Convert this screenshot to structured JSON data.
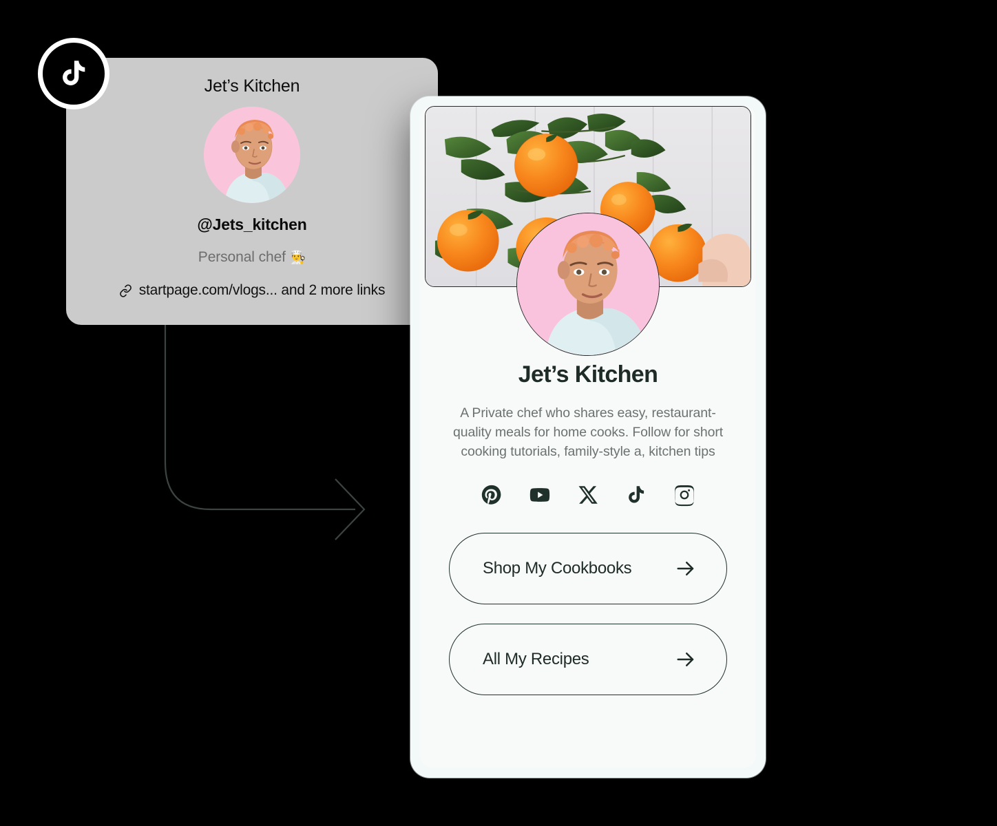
{
  "theme": {
    "background": "#000000",
    "card_bg": "#cbcbcb",
    "phone_frame": "#f3f8f8",
    "screen_bg": "#f8faf9",
    "text_dark": "#1e2b26",
    "text_muted": "#6b7270",
    "avatar_pink": "#f9c2dd",
    "accent_orange": "#f58220"
  },
  "badge": {
    "platform": "tiktok",
    "icon": "tiktok-icon"
  },
  "profile_card": {
    "title": "Jet’s Kitchen",
    "avatar_alt": "profile-photo",
    "handle": "@Jets_kitchen",
    "bio": "Personal chef",
    "bio_emoji": "👨‍🍳",
    "link_icon": "link-chain-icon",
    "links_text": "startpage.com/vlogs... and 2 more links"
  },
  "phone": {
    "cover_alt": "oranges-flatlay-cover-image",
    "avatar_alt": "profile-photo",
    "title": "Jet’s Kitchen",
    "bio": "A Private chef who shares easy, restaurant-quality meals for home cooks. Follow for short cooking tutorials, family-style a, kitchen tips",
    "socials": [
      {
        "name": "pinterest",
        "icon": "pinterest-icon"
      },
      {
        "name": "youtube",
        "icon": "youtube-icon"
      },
      {
        "name": "x",
        "icon": "x-icon"
      },
      {
        "name": "tiktok",
        "icon": "tiktok-icon"
      },
      {
        "name": "instagram",
        "icon": "instagram-icon"
      }
    ],
    "links": [
      {
        "label": "Shop My Cookbooks",
        "arrow": "arrow-right-icon"
      },
      {
        "label": "All My Recipes",
        "arrow": "arrow-right-icon"
      }
    ]
  },
  "connector": {
    "type": "curved-arrow",
    "from": "profile-card",
    "to": "phone-preview"
  }
}
